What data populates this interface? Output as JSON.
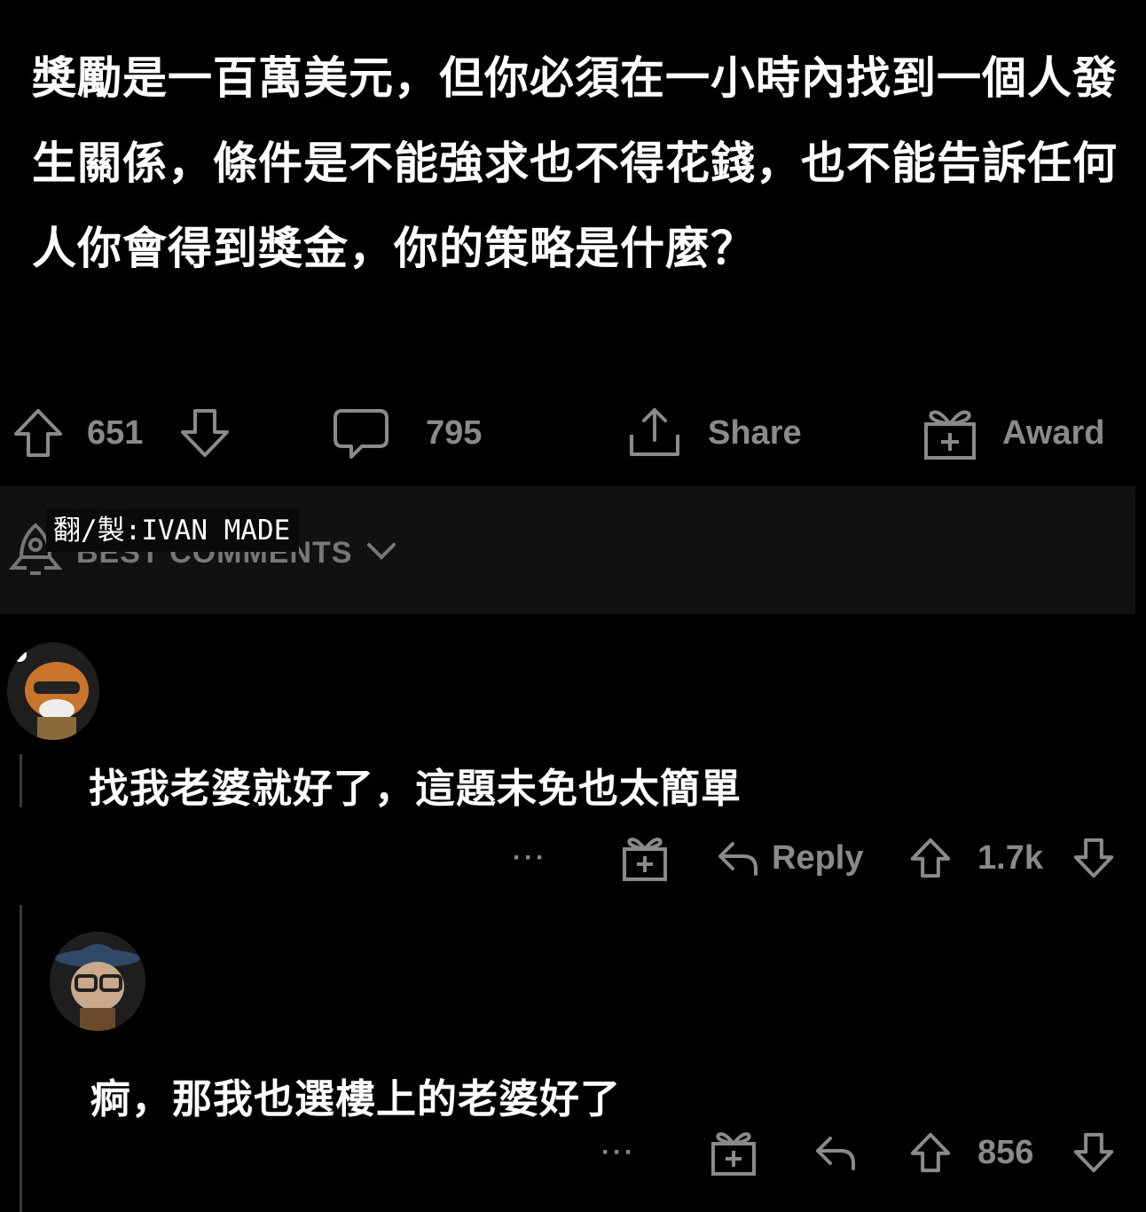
{
  "post": {
    "title": "獎勵是一百萬美元，但你必須在一小時內找到一個人發生關係，條件是不能強求也不得花錢，也不能告訴任何人你會得到獎金，你的策略是什麼？"
  },
  "actions": {
    "upvotes": "651",
    "comments": "795",
    "share_label": "Share",
    "award_label": "Award"
  },
  "sort": {
    "label": "BEST COMMENTS"
  },
  "watermark": "翻/製:IVAN MADE",
  "comments": [
    {
      "text": "找我老婆就好了，這題未免也太簡單",
      "more": "···",
      "reply_label": "Reply",
      "votes": "1.7k"
    },
    {
      "text": "痾，那我也選樓上的老婆好了",
      "more": "···",
      "votes": "856"
    }
  ],
  "icons": {
    "upvote": "arrow-up-outline-icon",
    "downvote": "arrow-down-outline-icon",
    "comment": "speech-bubble-icon",
    "share": "share-upload-icon",
    "award": "gift-award-icon",
    "reply": "reply-arrow-icon",
    "sort": "rocket-icon",
    "chevron": "chevron-down-icon"
  },
  "colors": {
    "background": "#000000",
    "text": "#ffffff",
    "muted": "#8a8a8a",
    "sort_bar": "#111111"
  }
}
